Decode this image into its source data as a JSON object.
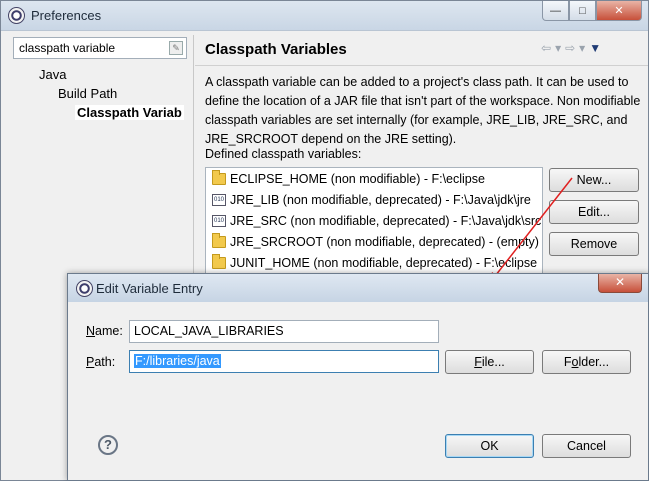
{
  "window": {
    "title": "Preferences",
    "controls": {
      "minimize": "—",
      "maximize": "□",
      "close": "✕"
    }
  },
  "filter": {
    "value": "classpath variable"
  },
  "tree": [
    {
      "label": "Java"
    },
    {
      "label": "Build Path"
    },
    {
      "label": "Classpath Variab"
    }
  ],
  "page": {
    "title": "Classpath Variables",
    "description": "A classpath variable can be added to a project's class path. It can be used to define the location of a JAR file that isn't part of the workspace. Non modifiable classpath variables are set internally (for example, JRE_LIB, JRE_SRC, and JRE_SRCROOT depend on the JRE setting).",
    "list_label": "Defined classpath variables:",
    "variables": [
      {
        "text": "ECLIPSE_HOME (non modifiable) - F:\\eclipse",
        "icon": "folder-icon"
      },
      {
        "text": "JRE_LIB (non modifiable, deprecated) - F:\\Java\\jdk\\jre",
        "icon": "jar-icon"
      },
      {
        "text": "JRE_SRC (non modifiable, deprecated) - F:\\Java\\jdk\\src",
        "icon": "jar-icon"
      },
      {
        "text": "JRE_SRCROOT (non modifiable, deprecated) - (empty)",
        "icon": "folder-icon"
      },
      {
        "text": "JUNIT_HOME (non modifiable, deprecated) - F:\\eclipse",
        "icon": "folder-icon"
      }
    ],
    "buttons": {
      "new": "New...",
      "edit": "Edit...",
      "remove": "Remove"
    }
  },
  "dialog": {
    "title": "Edit Variable Entry",
    "name_label_u": "N",
    "name_label_rest": "ame:",
    "name_value": "LOCAL_JAVA_LIBRARIES",
    "path_label_u": "P",
    "path_label_rest": "ath:",
    "path_value": "F:/libraries/java",
    "file_button_pre": "",
    "file_button_u": "F",
    "file_button_post": "ile...",
    "folder_button_pre": "F",
    "folder_button_u": "o",
    "folder_button_post": "lder...",
    "ok": "OK",
    "cancel": "Cancel",
    "help": "?",
    "close": "✕"
  },
  "colors": {
    "accent": "#3399ff",
    "arrow": "#e02020"
  }
}
